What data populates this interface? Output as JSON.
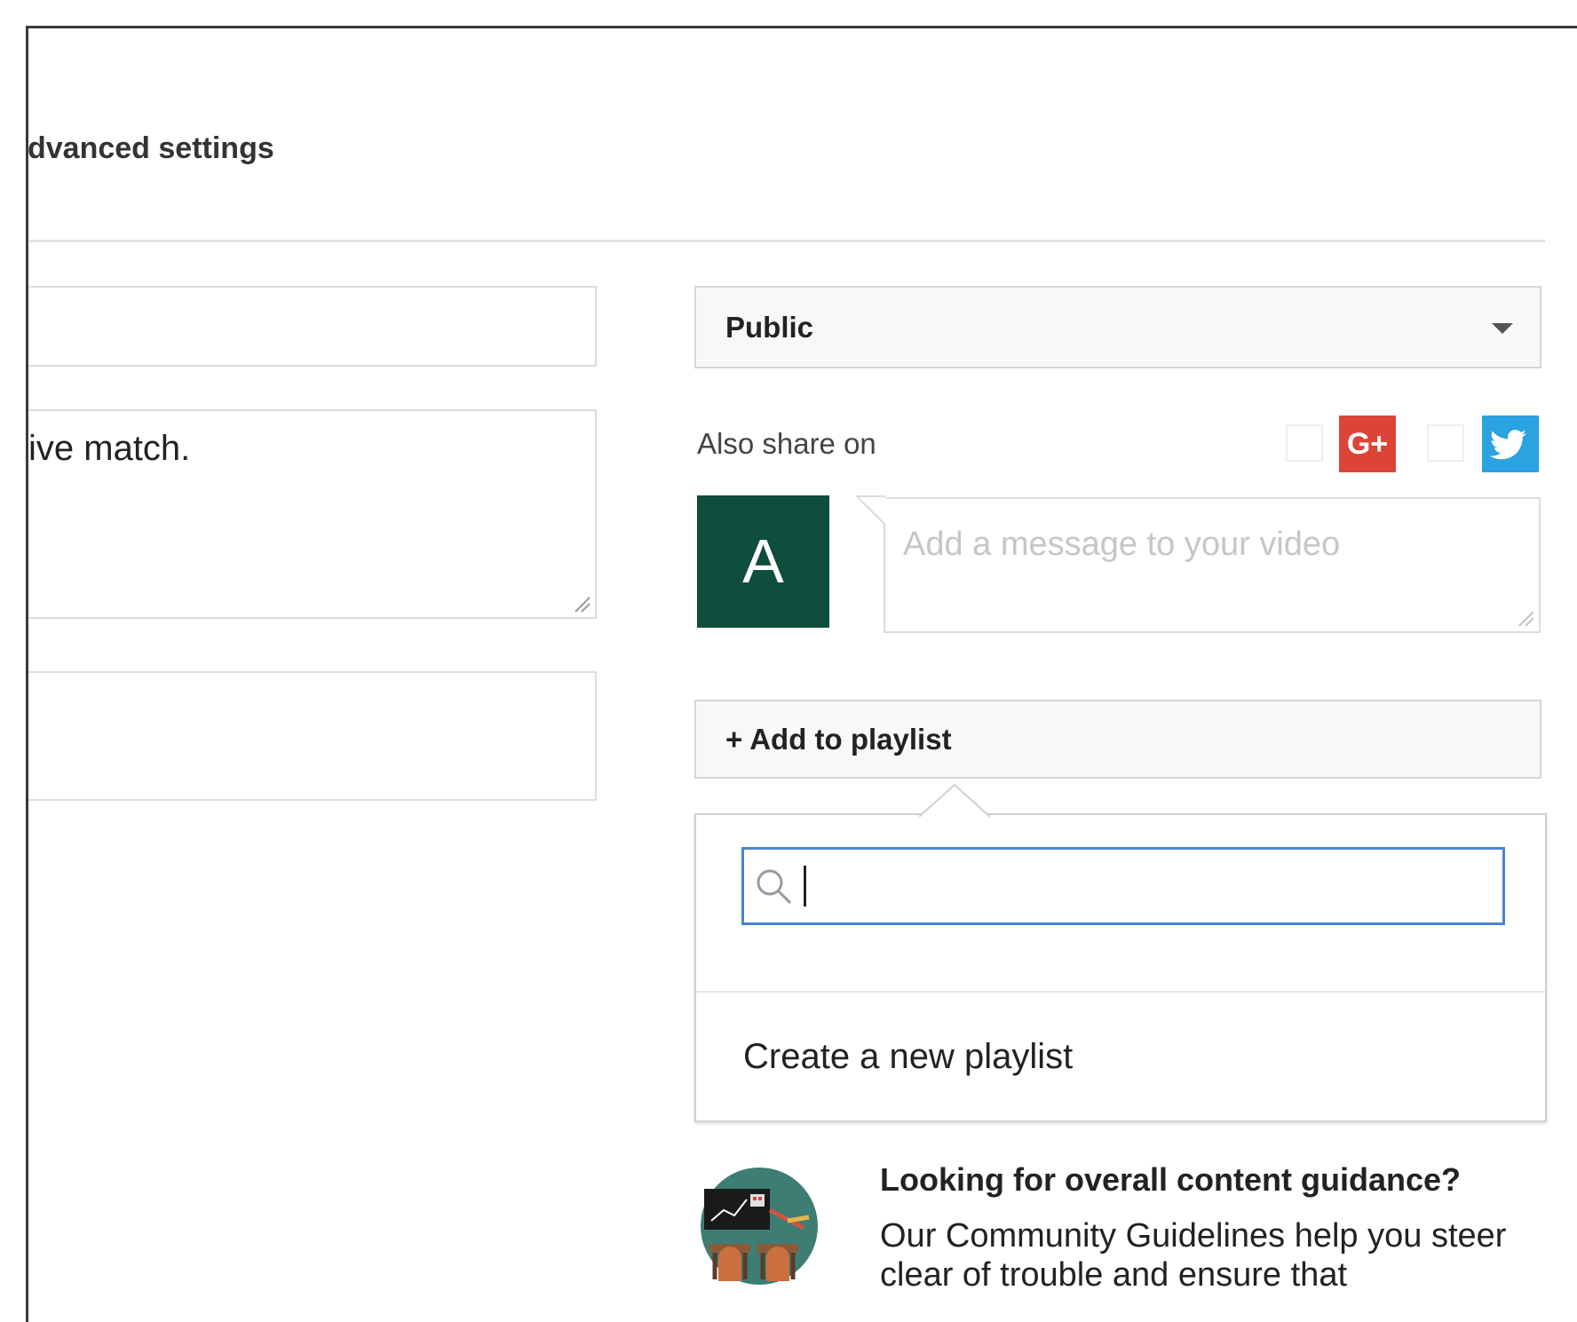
{
  "header": {
    "tab_label": "dvanced settings"
  },
  "left_column": {
    "title_value": "",
    "description_value": "ive match.",
    "tags_value": ""
  },
  "privacy": {
    "selected": "Public"
  },
  "share": {
    "label": "Also share on",
    "gplus_text": "G+",
    "gplus_checked": false,
    "twitter_checked": false,
    "gplus_color": "#dc4437",
    "twitter_color": "#2aa3e0"
  },
  "message": {
    "avatar_letter": "A",
    "avatar_color": "#0f4d3d",
    "placeholder": "Add a message to your video"
  },
  "playlist": {
    "button_label": "+ Add to playlist",
    "search_value": "",
    "create_label": "Create a new playlist",
    "search_border_color": "#4c83d1"
  },
  "guidance": {
    "heading": "Looking for overall content guidance?",
    "body": "Our Community Guidelines help you steer clear of trouble and ensure that"
  },
  "icons": {
    "search": "search-icon",
    "caret": "chevron-down-icon",
    "gplus": "google-plus-icon",
    "twitter": "twitter-bird-icon",
    "resize": "resize-grip-icon"
  }
}
